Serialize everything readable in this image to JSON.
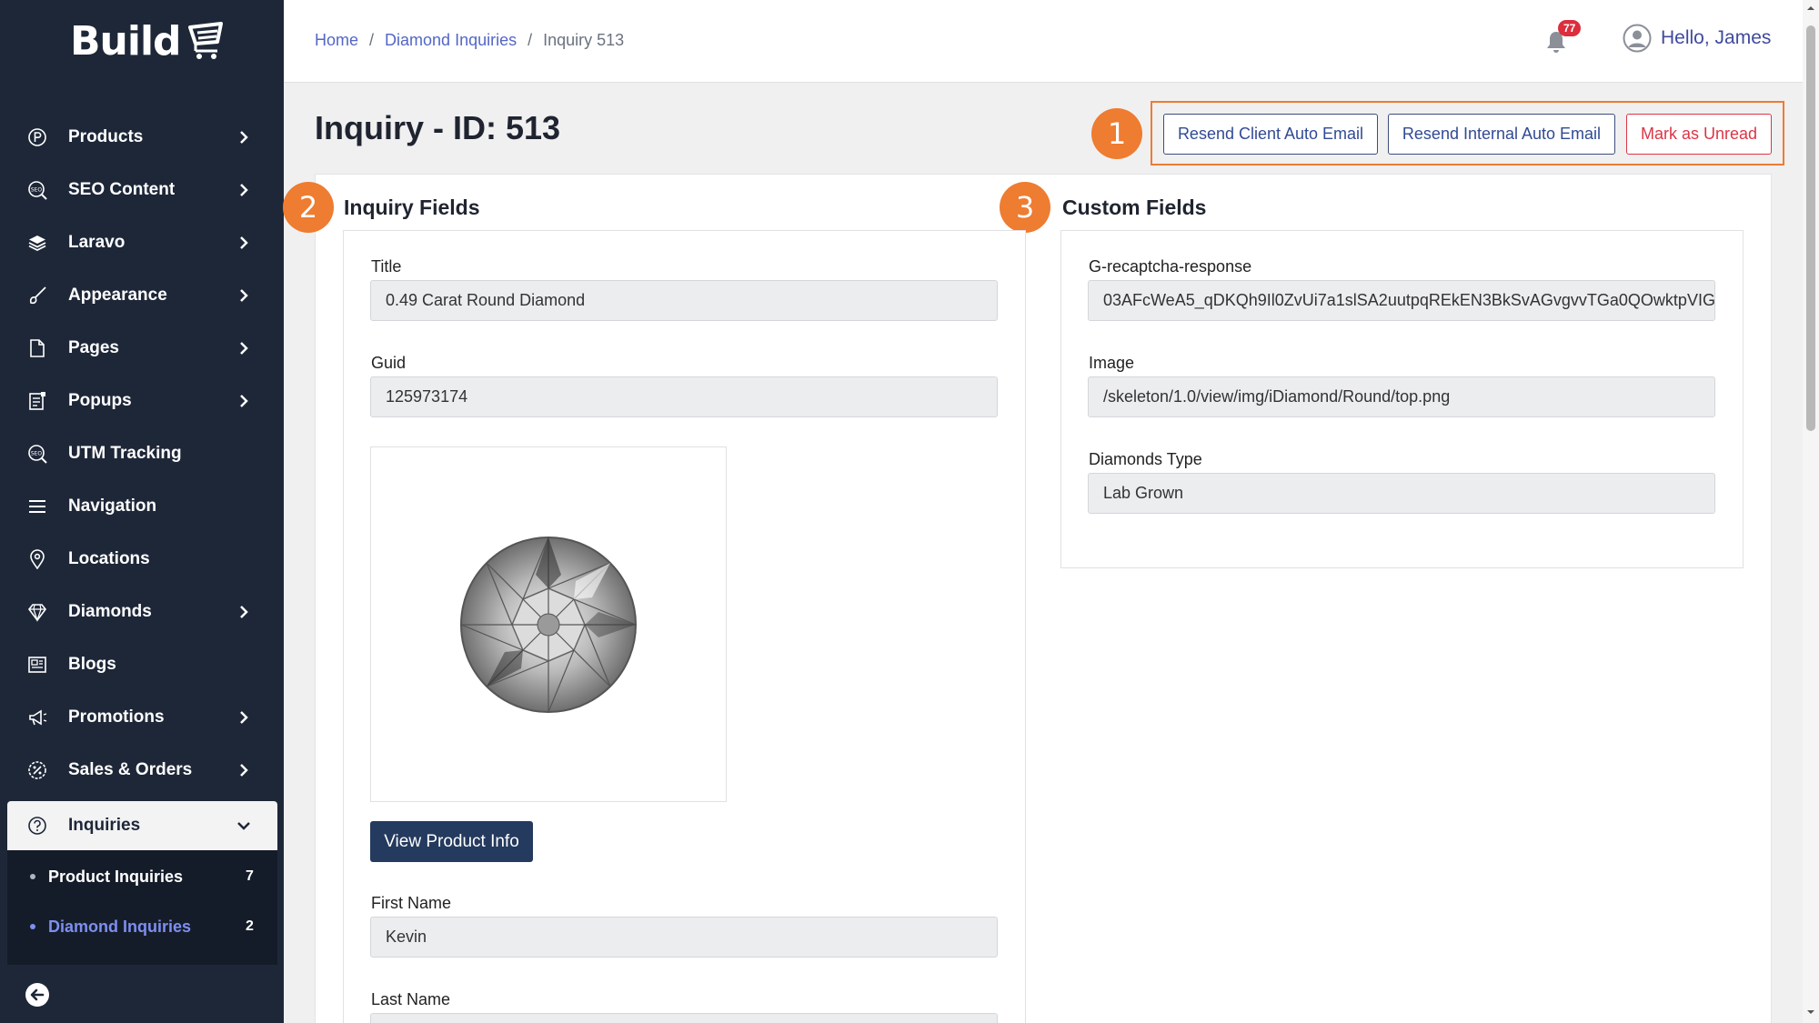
{
  "app": {
    "logo_text": "Build"
  },
  "sidebar": {
    "items": [
      {
        "label": "Products",
        "icon": "product-p-icon",
        "has_children": true
      },
      {
        "label": "SEO Content",
        "icon": "seo-icon",
        "has_children": true
      },
      {
        "label": "Laravo",
        "icon": "layers-icon",
        "has_children": true
      },
      {
        "label": "Appearance",
        "icon": "brush-icon",
        "has_children": true
      },
      {
        "label": "Pages",
        "icon": "page-icon",
        "has_children": true
      },
      {
        "label": "Popups",
        "icon": "popup-icon",
        "has_children": true
      },
      {
        "label": "UTM Tracking",
        "icon": "seo-icon",
        "has_children": false
      },
      {
        "label": "Navigation",
        "icon": "menu-icon",
        "has_children": false
      },
      {
        "label": "Locations",
        "icon": "location-pin-icon",
        "has_children": false
      },
      {
        "label": "Diamonds",
        "icon": "diamond-icon",
        "has_children": true
      },
      {
        "label": "Blogs",
        "icon": "newspaper-icon",
        "has_children": false
      },
      {
        "label": "Promotions",
        "icon": "megaphone-icon",
        "has_children": true
      },
      {
        "label": "Sales & Orders",
        "icon": "percent-badge-icon",
        "has_children": true
      },
      {
        "label": "Inquiries",
        "icon": "question-circle-icon",
        "has_children": true,
        "expanded": true
      }
    ],
    "submenu": [
      {
        "label": "Product Inquiries",
        "count": "7"
      },
      {
        "label": "Diamond Inquiries",
        "count": "2",
        "current": true
      }
    ]
  },
  "topbar": {
    "breadcrumb": [
      "Home",
      "Diamond Inquiries",
      "Inquiry 513"
    ],
    "notification_count": "77",
    "greeting": "Hello, James"
  },
  "page": {
    "title": "Inquiry - ID: 513",
    "actions": {
      "resend_client": "Resend Client Auto Email",
      "resend_internal": "Resend Internal Auto Email",
      "mark_unread": "Mark as Unread"
    },
    "steps": [
      "1",
      "2",
      "3"
    ]
  },
  "inquiry_fields": {
    "heading": "Inquiry Fields",
    "title_label": "Title",
    "title_value": "0.49 Carat Round Diamond",
    "guid_label": "Guid",
    "guid_value": "125973174",
    "view_product_button": "View Product Info",
    "first_name_label": "First Name",
    "first_name_value": "Kevin",
    "last_name_label": "Last Name"
  },
  "custom_fields": {
    "heading": "Custom Fields",
    "recaptcha_label": "G-recaptcha-response",
    "recaptcha_value": "03AFcWeA5_qDKQh9Il0ZvUi7a1slSA2uutpqREkEN3BkSvAGvgvvTGa0QOwktpVIG",
    "image_label": "Image",
    "image_value": "/skeleton/1.0/view/img/iDiamond/Round/top.png",
    "diamonds_type_label": "Diamonds Type",
    "diamonds_type_value": "Lab Grown"
  },
  "colors": {
    "sidebar_bg": "#1e2738",
    "accent_orange": "#ee7c31",
    "primary_dark": "#243a5e",
    "link_blue": "#5367c6",
    "danger": "#dc3545"
  }
}
